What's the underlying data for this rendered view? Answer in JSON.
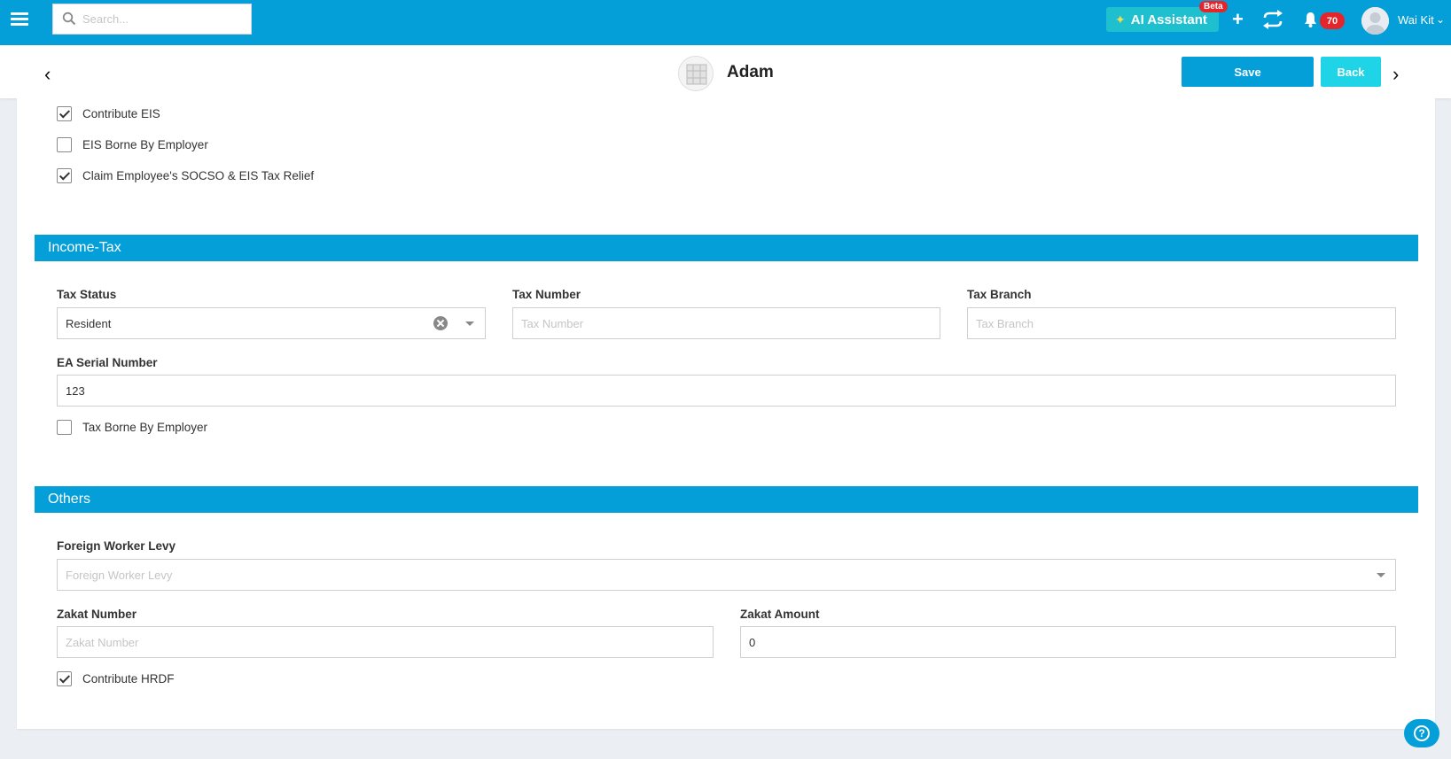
{
  "topbar": {
    "search_placeholder": "Search...",
    "ai_assistant_label": "AI Assistant",
    "beta_badge": "Beta",
    "notification_count": "70",
    "user_name": "Wai Kit",
    "accent_color": "#049ed8"
  },
  "header": {
    "employee_name": "Adam",
    "save_label": "Save",
    "back_label": "Back"
  },
  "socso_eis": {
    "contribute_eis": {
      "label": "Contribute EIS",
      "checked": true
    },
    "eis_borne": {
      "label": "EIS Borne By Employer",
      "checked": false
    },
    "claim_relief": {
      "label": "Claim Employee's SOCSO & EIS Tax Relief",
      "checked": true
    }
  },
  "income_tax": {
    "title": "Income-Tax",
    "tax_status": {
      "label": "Tax Status",
      "value": "Resident"
    },
    "tax_number": {
      "label": "Tax Number",
      "placeholder": "Tax Number"
    },
    "tax_branch": {
      "label": "Tax Branch",
      "placeholder": "Tax Branch"
    },
    "ea_serial": {
      "label": "EA Serial Number",
      "value": "123"
    },
    "tax_borne": {
      "label": "Tax Borne By Employer",
      "checked": false
    }
  },
  "others": {
    "title": "Others",
    "foreign_levy": {
      "label": "Foreign Worker Levy",
      "placeholder": "Foreign Worker Levy"
    },
    "zakat_number": {
      "label": "Zakat Number",
      "placeholder": "Zakat Number"
    },
    "zakat_amount": {
      "label": "Zakat Amount",
      "value": "0"
    },
    "contribute_hrdf": {
      "label": "Contribute HRDF",
      "checked": true
    }
  }
}
